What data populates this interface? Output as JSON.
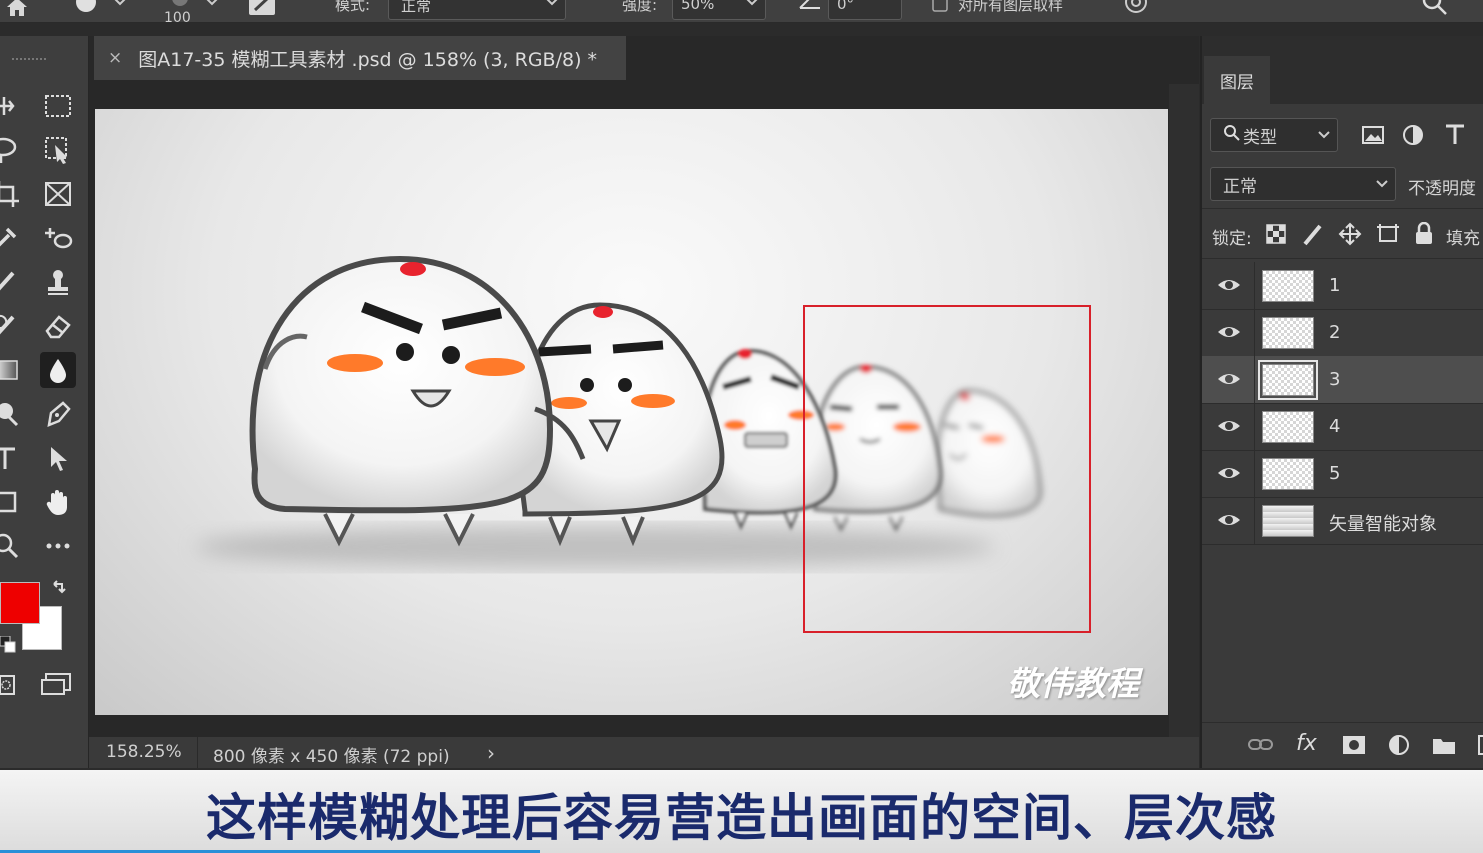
{
  "options_bar": {
    "brush_size": "100",
    "mode_label": "模式:",
    "mode_value": "正常",
    "strength_label": "强度:",
    "strength_value": "50%",
    "angle_value": "0°",
    "sample_all_layers_label": "对所有图层取样",
    "sample_all_layers_checked": false
  },
  "document": {
    "tab_close": "×",
    "tab_title": "图A17-35 模糊工具素材 .psd @ 158% (3, RGB/8) *",
    "watermark": "敬伟教程",
    "zoom": "158.25%",
    "doc_info": "800 像素 x 450 像素 (72 ppi)",
    "status_arrow": "›"
  },
  "colors": {
    "foreground": "#ee0000",
    "background": "#ffffff",
    "selection_rect": "#d8202a",
    "subtitle_text": "#1a2a6c"
  },
  "layers_panel": {
    "tab_label": "图层",
    "filter_kind": "类型",
    "blend_mode": "正常",
    "opacity_label": "不透明度",
    "lock_label": "锁定:",
    "fill_label": "填充",
    "layers": [
      {
        "name": "1",
        "visible": true,
        "selected": false
      },
      {
        "name": "2",
        "visible": true,
        "selected": false
      },
      {
        "name": "3",
        "visible": true,
        "selected": true
      },
      {
        "name": "4",
        "visible": true,
        "selected": false
      },
      {
        "name": "5",
        "visible": true,
        "selected": false
      },
      {
        "name": "矢量智能对象",
        "visible": true,
        "selected": false
      }
    ],
    "footer_fx": "fx"
  },
  "subtitle": "这样模糊处理后容易营造出画面的空间、层次感"
}
